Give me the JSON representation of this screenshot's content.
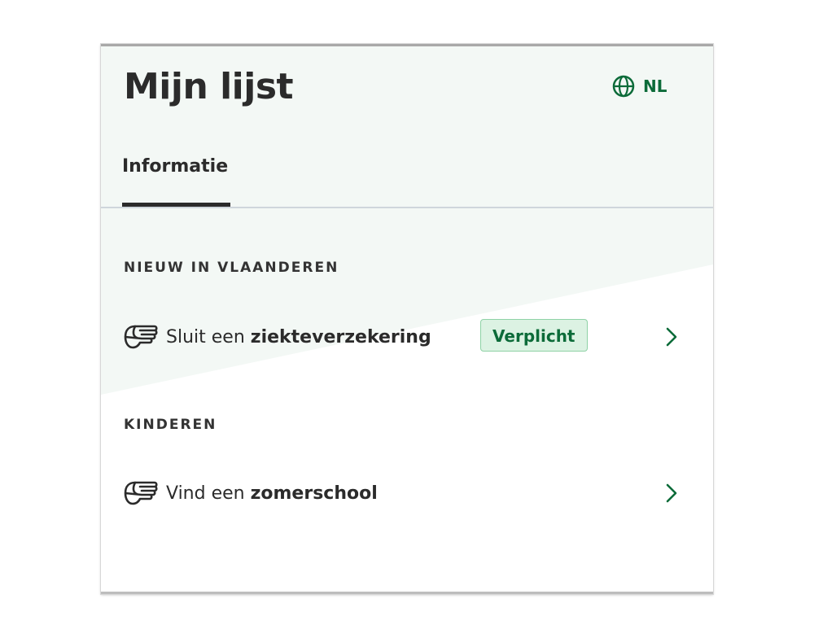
{
  "header": {
    "title": "Mijn lijst",
    "language": "NL"
  },
  "tabs": [
    {
      "label": "Informatie",
      "active": true
    }
  ],
  "sections": [
    {
      "title": "NIEUW IN VLAANDEREN",
      "items": [
        {
          "icon": "pointing-hand-icon",
          "prefix": "Sluit een ",
          "emphasis": "ziekteverzekering",
          "badge": "Verplicht"
        }
      ]
    },
    {
      "title": "KINDEREN",
      "items": [
        {
          "icon": "pointing-hand-icon",
          "prefix": "Vind een ",
          "emphasis": "zomerschool"
        }
      ]
    }
  ],
  "colors": {
    "accent_green": "#0c6b39",
    "badge_bg": "#dcf2e3",
    "header_bg": "#f3f8f5",
    "text": "#2b2b2b"
  },
  "icons": {
    "language": "globe-icon",
    "row_arrow": "chevron-right-icon"
  }
}
